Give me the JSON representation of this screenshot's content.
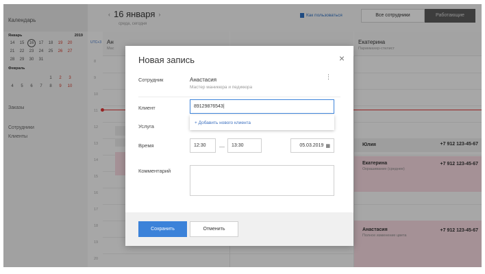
{
  "sidebar": {
    "calendar_label": "Календарь",
    "month": "Январь",
    "year": "2019",
    "weeks": [
      [
        "14",
        "15",
        "16",
        "17",
        "18",
        "19",
        "20"
      ],
      [
        "21",
        "22",
        "23",
        "24",
        "25",
        "26",
        "27"
      ],
      [
        "28",
        "29",
        "30",
        "31",
        "",
        "",
        ""
      ]
    ],
    "next_month": "Февраль",
    "next_weeks": [
      [
        "",
        "",
        "",
        "",
        "1",
        "2",
        "3"
      ],
      [
        "4",
        "5",
        "6",
        "7",
        "8",
        "9",
        "10"
      ]
    ],
    "nav": [
      "Заказы",
      "Сотрудники",
      "Клиенты"
    ]
  },
  "header": {
    "date_title": "16 января",
    "date_sub": "среда, сегодня",
    "prev_arrow": "‹",
    "next_arrow": "›",
    "howto": "Как пользоваться",
    "btn_all": "Все сотрудники",
    "btn_working": "Работающие"
  },
  "calendar": {
    "utc": "UTC+3",
    "hours": [
      "8",
      "9",
      "10",
      "11",
      "12",
      "13",
      "14",
      "15",
      "16",
      "17",
      "18",
      "19",
      "20"
    ],
    "col1_name": "Ан",
    "col1_role": "Мас",
    "col3_name": "Екатерина",
    "col3_role": "Парикмахер-стилист",
    "events": [
      {
        "title": "Юлия",
        "phone": "+7 912 123-45-67",
        "subtitle": ""
      },
      {
        "title": "Екатерина",
        "phone": "+7 912 123-45-67",
        "subtitle": "Окрашивание (среднее)"
      },
      {
        "title": "Анастасия",
        "phone": "+7 912 123-45-67",
        "subtitle": "Полное изменение цвета"
      }
    ]
  },
  "modal": {
    "title": "Новая запись",
    "close": "×",
    "employee_label": "Сотрудник",
    "employee_name": "Анастасия",
    "employee_role": "Мастер маникюра и педикюра",
    "client_label": "Клиент",
    "client_value": "89129876543|",
    "add_client": "+ Добавить нового клиента",
    "service_label": "Услуга",
    "time_label": "Время",
    "time_from": "12:30",
    "time_dash": "—",
    "time_to": "13:30",
    "date_value": "05.03.2019",
    "comment_label": "Комментарий",
    "save": "Сохранить",
    "cancel": "Отменить"
  },
  "colors": {
    "accent": "#3b82d9",
    "event_pink": "#f3d6dd",
    "now_line": "#dd3333"
  }
}
